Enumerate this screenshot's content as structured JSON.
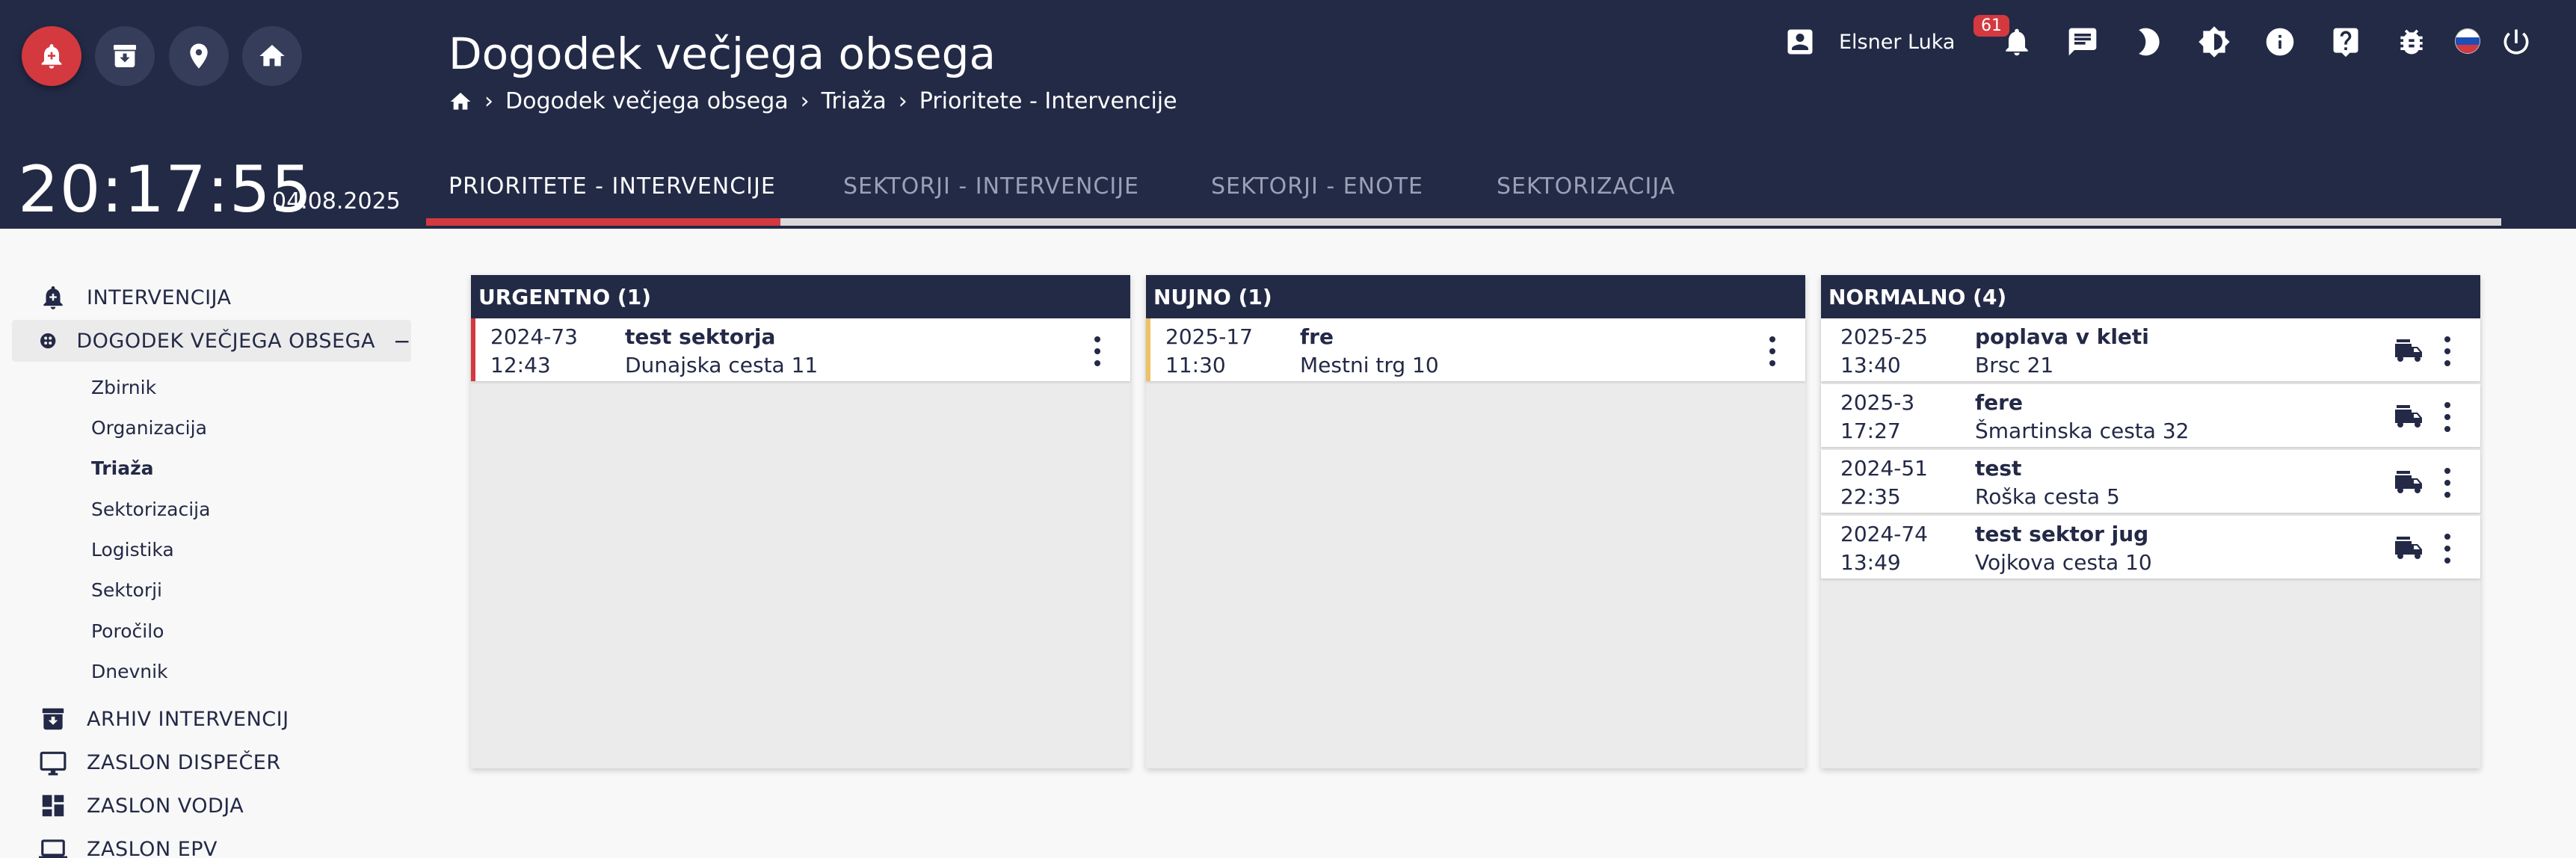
{
  "header": {
    "title": "Dogodek večjega obsega",
    "breadcrumb": [
      "Dogodek večjega obsega",
      "Triaža",
      "Prioritete - Intervencije"
    ],
    "clock": "20:17:55",
    "date": "04.08.2025",
    "user_name": "Elsner Luka",
    "notification_count": "61",
    "left_buttons": [
      "alarm-icon",
      "archive-icon",
      "map-pin-icon",
      "home-icon"
    ],
    "right_icons": [
      "bell-icon",
      "chat-icon",
      "moon-icon",
      "brightness-icon",
      "info-icon",
      "help-icon",
      "bug-icon",
      "flag-icon",
      "power-icon"
    ]
  },
  "tabs": [
    {
      "label": "PRIORITETE - INTERVENCIJE",
      "active": true
    },
    {
      "label": "SEKTORJI - INTERVENCIJE",
      "active": false
    },
    {
      "label": "SEKTORJI - ENOTE",
      "active": false
    },
    {
      "label": "SEKTORIZACIJA",
      "active": false
    }
  ],
  "sidebar": {
    "items": [
      {
        "label": "INTERVENCIJA",
        "icon": "alarm-icon"
      },
      {
        "label": "DOGODEK VEČJEGA OBSEGA",
        "icon": "group-icon",
        "collapse": "−"
      },
      {
        "label": "ARHIV INTERVENCIJ",
        "icon": "archive-icon"
      },
      {
        "label": "ZASLON DISPEČER",
        "icon": "monitor-icon"
      },
      {
        "label": "ZASLON VODJA",
        "icon": "dashboard-icon"
      },
      {
        "label": "ZASLON EPV",
        "icon": "laptop-icon"
      }
    ],
    "subitems": [
      "Zbirnik",
      "Organizacija",
      "Triaža",
      "Sektorizacija",
      "Logistika",
      "Sektorji",
      "Poročilo",
      "Dnevnik"
    ]
  },
  "panels": [
    {
      "title": "URGENTNO (1)",
      "stripe_color": "#d3393f",
      "cards": [
        {
          "num": "2024-73",
          "time": "12:43",
          "name": "test sektorja",
          "addr": "Dunajska cesta 11",
          "truck": false
        }
      ]
    },
    {
      "title": "NUJNO (1)",
      "stripe_color": "#f0c064",
      "cards": [
        {
          "num": "2025-17",
          "time": "11:30",
          "name": "fre",
          "addr": "Mestni trg 10",
          "truck": false
        }
      ]
    },
    {
      "title": "NORMALNO (4)",
      "stripe_color": "",
      "cards": [
        {
          "num": "2025-25",
          "time": "13:40",
          "name": "poplava v kleti",
          "addr": "Brsc 21",
          "truck": true
        },
        {
          "num": "2025-3",
          "time": "17:27",
          "name": "fere",
          "addr": "Šmartinska cesta 32",
          "truck": true
        },
        {
          "num": "2024-51",
          "time": "22:35",
          "name": "test",
          "addr": "Roška cesta 5",
          "truck": true
        },
        {
          "num": "2024-74",
          "time": "13:49",
          "name": "test sektor jug",
          "addr": "Vojkova cesta 10",
          "truck": true
        }
      ]
    }
  ],
  "colors": {
    "header_bg": "#222a46",
    "accent_red": "#d3393f",
    "urgent": "#d3393f",
    "nujno": "#f0c064"
  }
}
